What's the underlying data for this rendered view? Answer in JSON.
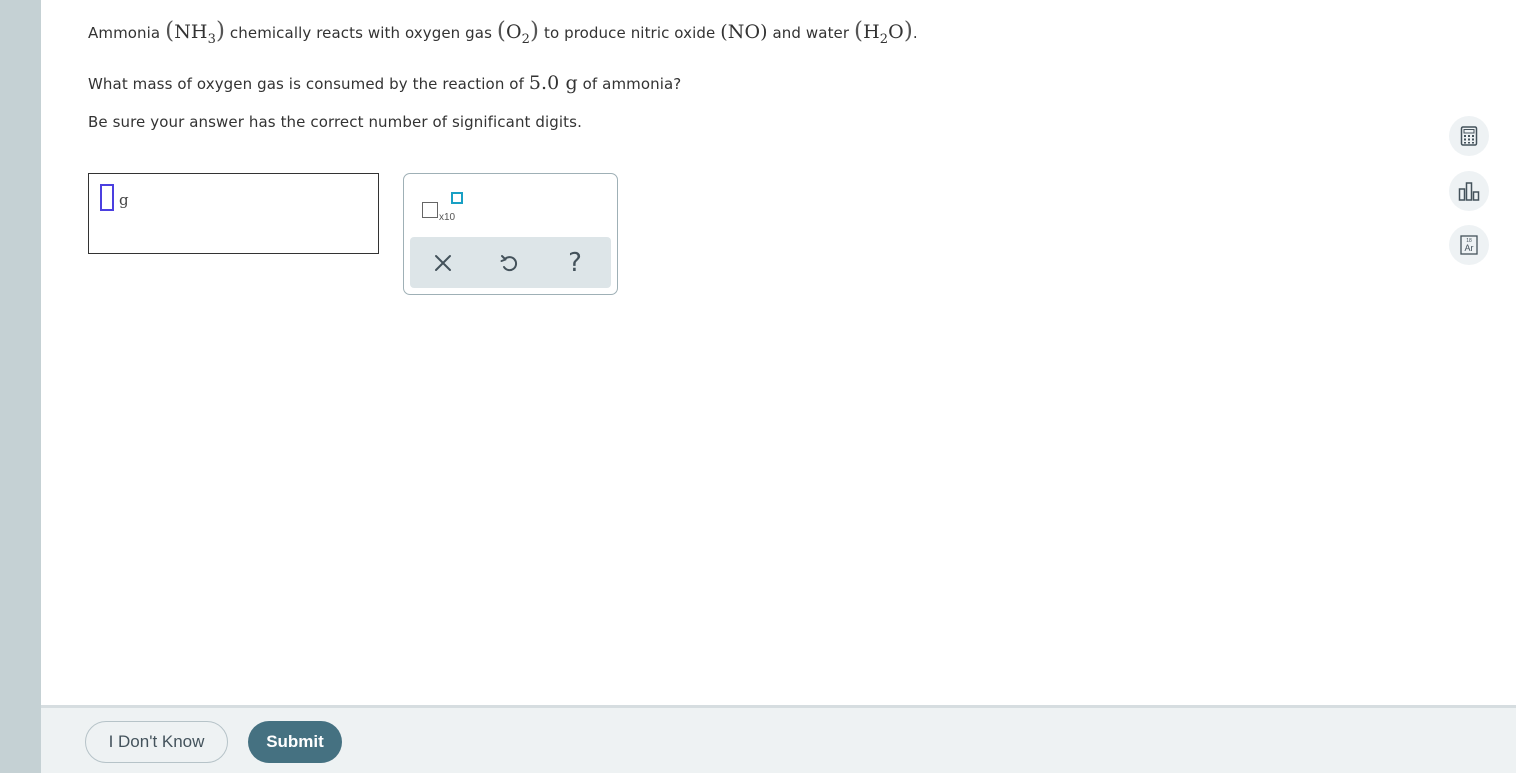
{
  "question": {
    "line1": {
      "t1": "Ammonia",
      "nh3_main": "NH",
      "nh3_sub": "3",
      "t2": "chemically reacts with oxygen gas",
      "o2_main": "O",
      "o2_sub": "2",
      "t3": "to produce nitric oxide",
      "no": "NO",
      "t4": "and water",
      "h2o_a": "H",
      "h2o_sub": "2",
      "h2o_b": "O",
      "end": "."
    },
    "line2": {
      "t1": "What mass of oxygen gas is consumed by the reaction of",
      "amount": "5.0 g",
      "t2": "of ammonia?"
    },
    "line3": "Be sure your answer has the correct number of significant digits."
  },
  "answer": {
    "value": "",
    "unit": "g"
  },
  "palette": {
    "x10_label": "x10",
    "help_label": "?"
  },
  "side_tools": {
    "icons": [
      "calculator-icon",
      "bar-chart-icon",
      "periodic-table-icon"
    ],
    "ptable_text": "Ar",
    "ptable_num": "18"
  },
  "footer": {
    "dont_know_label": "I Don't Know",
    "submit_label": "Submit"
  },
  "colors": {
    "rail": "#c5d1d4",
    "submit_bg": "#457181",
    "cursor_slot": "#4b3fe0",
    "exponent_slot": "#19a0c4",
    "footer_bg": "#eef2f3"
  }
}
